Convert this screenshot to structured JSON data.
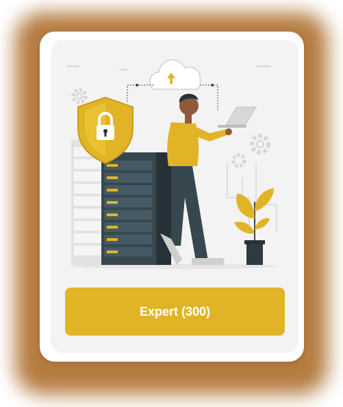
{
  "button": {
    "label": "Expert (300)"
  },
  "colors": {
    "accent": "#e1b427",
    "glow": "#a8641e",
    "server_dark": "#37474f",
    "server_light": "#e0e0e0",
    "plant_pot": "#2f3b40"
  },
  "icons": [
    "shield-lock-icon",
    "cloud-upload-icon",
    "gear-icon",
    "laptop-icon",
    "plant-icon"
  ]
}
